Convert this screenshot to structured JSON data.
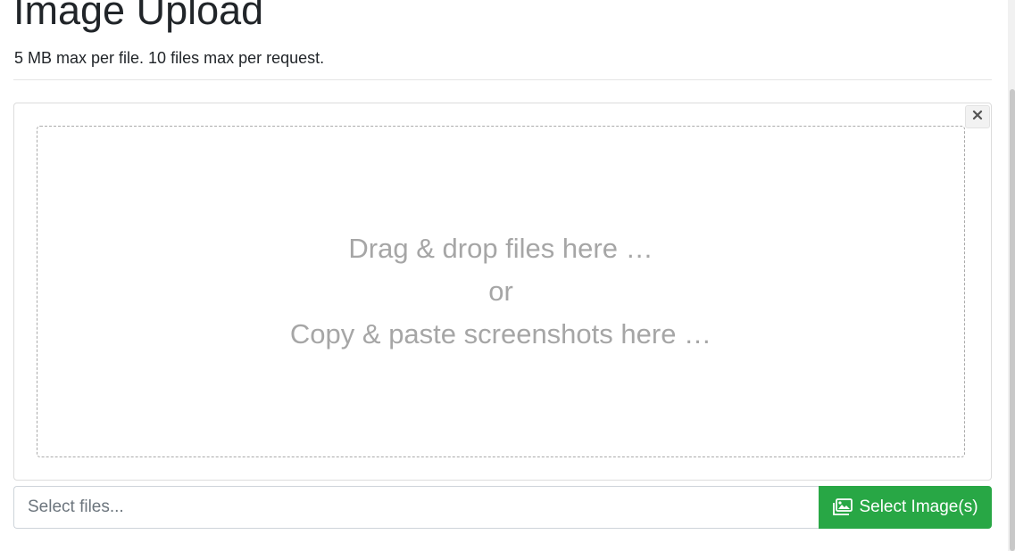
{
  "header": {
    "title": "Image Upload",
    "subtitle": "5 MB max per file. 10 files max per request."
  },
  "panel": {
    "close_icon": "close-icon",
    "close_glyph": "×",
    "dropzone": {
      "line1": "Drag & drop files here …",
      "line2": "or",
      "line3": "Copy & paste screenshots here …"
    }
  },
  "file_picker": {
    "placeholder": "Select files...",
    "button_label": "Select Image(s)",
    "button_icon": "images-icon",
    "button_color": "#28a745"
  }
}
